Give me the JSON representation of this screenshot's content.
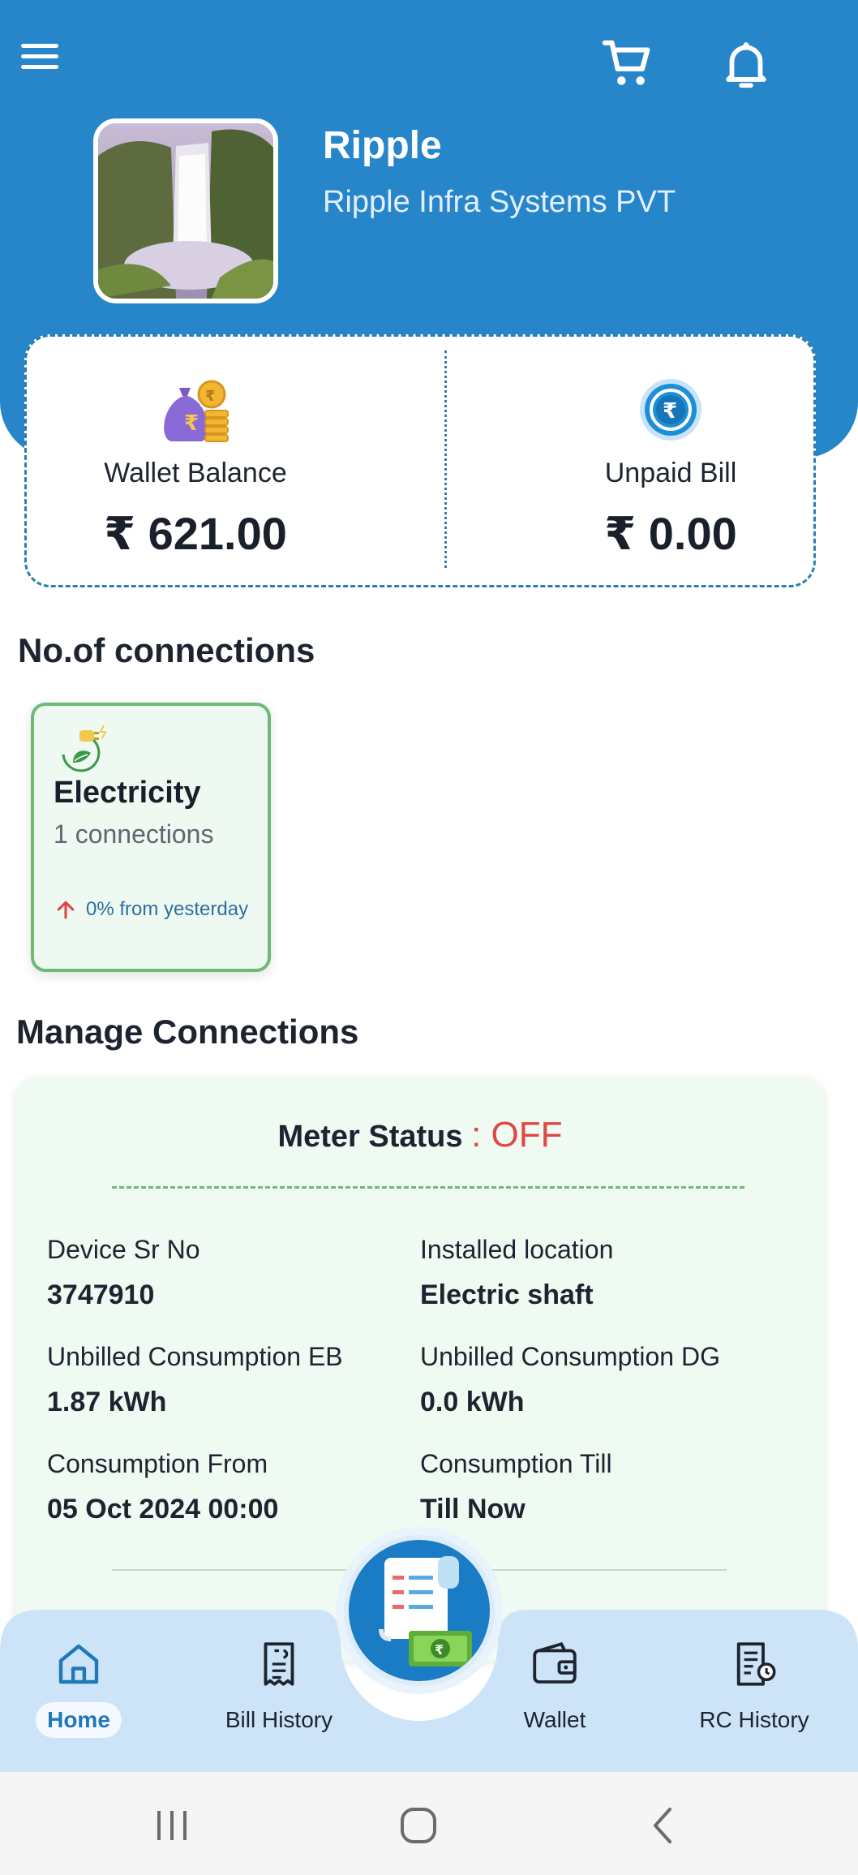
{
  "header": {
    "user_name": "Ripple",
    "company_name": "Ripple Infra Systems PVT",
    "icons": [
      "menu-icon",
      "cart-icon",
      "bell-icon"
    ],
    "accent_color": "#2786c9"
  },
  "summary": {
    "wallet_label": "Wallet Balance",
    "wallet_value": "₹ 621.00",
    "unpaid_label": "Unpaid Bill",
    "unpaid_value": "₹ 0.00"
  },
  "connections": {
    "section_title": "No.of connections",
    "tiles": [
      {
        "title": "Electricity",
        "count": "1 connections",
        "trend": "0% from yesterday"
      }
    ]
  },
  "manage": {
    "section_title": "Manage Connections",
    "meter_status_label": "Meter Status",
    "meter_status_value": ": OFF",
    "status_color": "#e04747",
    "fields": [
      {
        "label": "Device Sr No",
        "value": "3747910"
      },
      {
        "label": "Installed location",
        "value": "Electric shaft"
      },
      {
        "label": "Unbilled Consumption EB",
        "value": "1.87 kWh"
      },
      {
        "label": "Unbilled Consumption DG",
        "value": "0.0 kWh"
      },
      {
        "label": "Consumption From",
        "value": "05 Oct 2024 00:00"
      },
      {
        "label": "Consumption Till",
        "value": "Till Now"
      }
    ]
  },
  "bottom_nav": {
    "items": [
      {
        "label": "Home",
        "icon": "home-icon",
        "active": true
      },
      {
        "label": "Bill History",
        "icon": "bill-history-icon"
      },
      {
        "label": "Wallet",
        "icon": "wallet-icon"
      },
      {
        "label": "RC History",
        "icon": "rc-history-icon"
      }
    ],
    "fab_icon": "pay-bill-icon"
  },
  "system_nav": {
    "icons": [
      "recent-apps-icon",
      "home-circle-icon",
      "back-icon"
    ]
  }
}
